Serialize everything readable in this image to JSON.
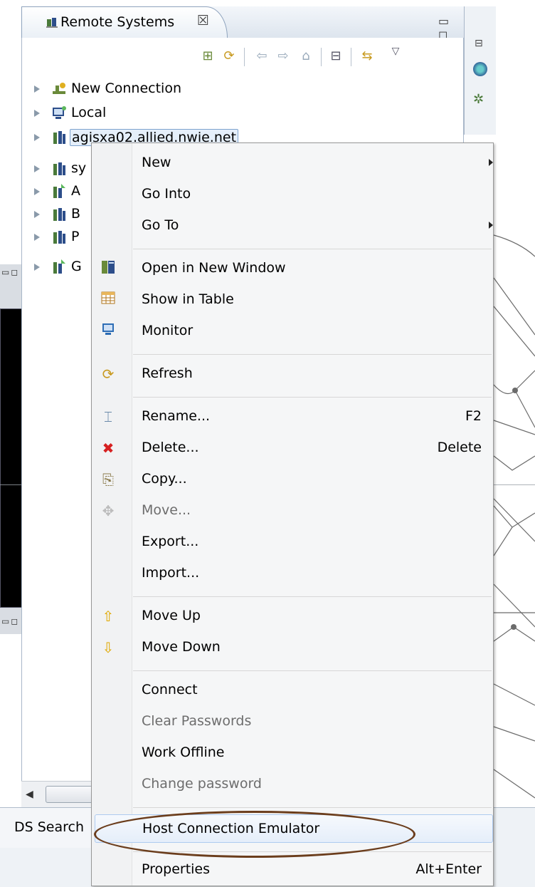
{
  "view": {
    "title": "Remote Systems",
    "close_glyph": "☒",
    "minmax": "▭ ◻"
  },
  "toolbar": {
    "icons": [
      "new-connection-icon",
      "refresh-icon",
      "back-icon",
      "forward-icon",
      "home-icon",
      "collapse-all-icon",
      "link-with-editor-icon",
      "view-menu-icon"
    ]
  },
  "tree": {
    "items": [
      {
        "label": "New Connection",
        "icon": "new-connection-icon"
      },
      {
        "label": "Local",
        "icon": "local-icon"
      },
      {
        "label": "agisxa02.allied.nwie.net",
        "icon": "server-icon",
        "selected": true
      },
      {
        "label": "sy",
        "icon": "server-icon"
      },
      {
        "label": "A",
        "icon": "server-connected-icon"
      },
      {
        "label": "B",
        "icon": "server-icon"
      },
      {
        "label": "P",
        "icon": "server-icon"
      },
      {
        "label": "G",
        "icon": "server-connected-icon"
      }
    ]
  },
  "bottom": {
    "tab_label": "DS Search"
  },
  "menu": {
    "items": {
      "new": "New",
      "go_into": "Go Into",
      "go_to": "Go To",
      "open_new_window": "Open in New Window",
      "show_in_table": "Show in Table",
      "monitor": "Monitor",
      "refresh": "Refresh",
      "rename": "Rename...",
      "rename_accel": "F2",
      "delete": "Delete...",
      "delete_accel": "Delete",
      "copy": "Copy...",
      "move": "Move...",
      "export": "Export...",
      "import": "Import...",
      "move_up": "Move Up",
      "move_down": "Move Down",
      "connect": "Connect",
      "clear_passwords": "Clear Passwords",
      "work_offline": "Work Offline",
      "change_password": "Change password",
      "host_emulator": "Host Connection Emulator",
      "properties": "Properties",
      "properties_accel": "Alt+Enter"
    }
  },
  "colors": {
    "highlight_ellipse": "#6b3d1c",
    "delete_icon": "#d62020",
    "arrow_icon": "#e0a800"
  }
}
